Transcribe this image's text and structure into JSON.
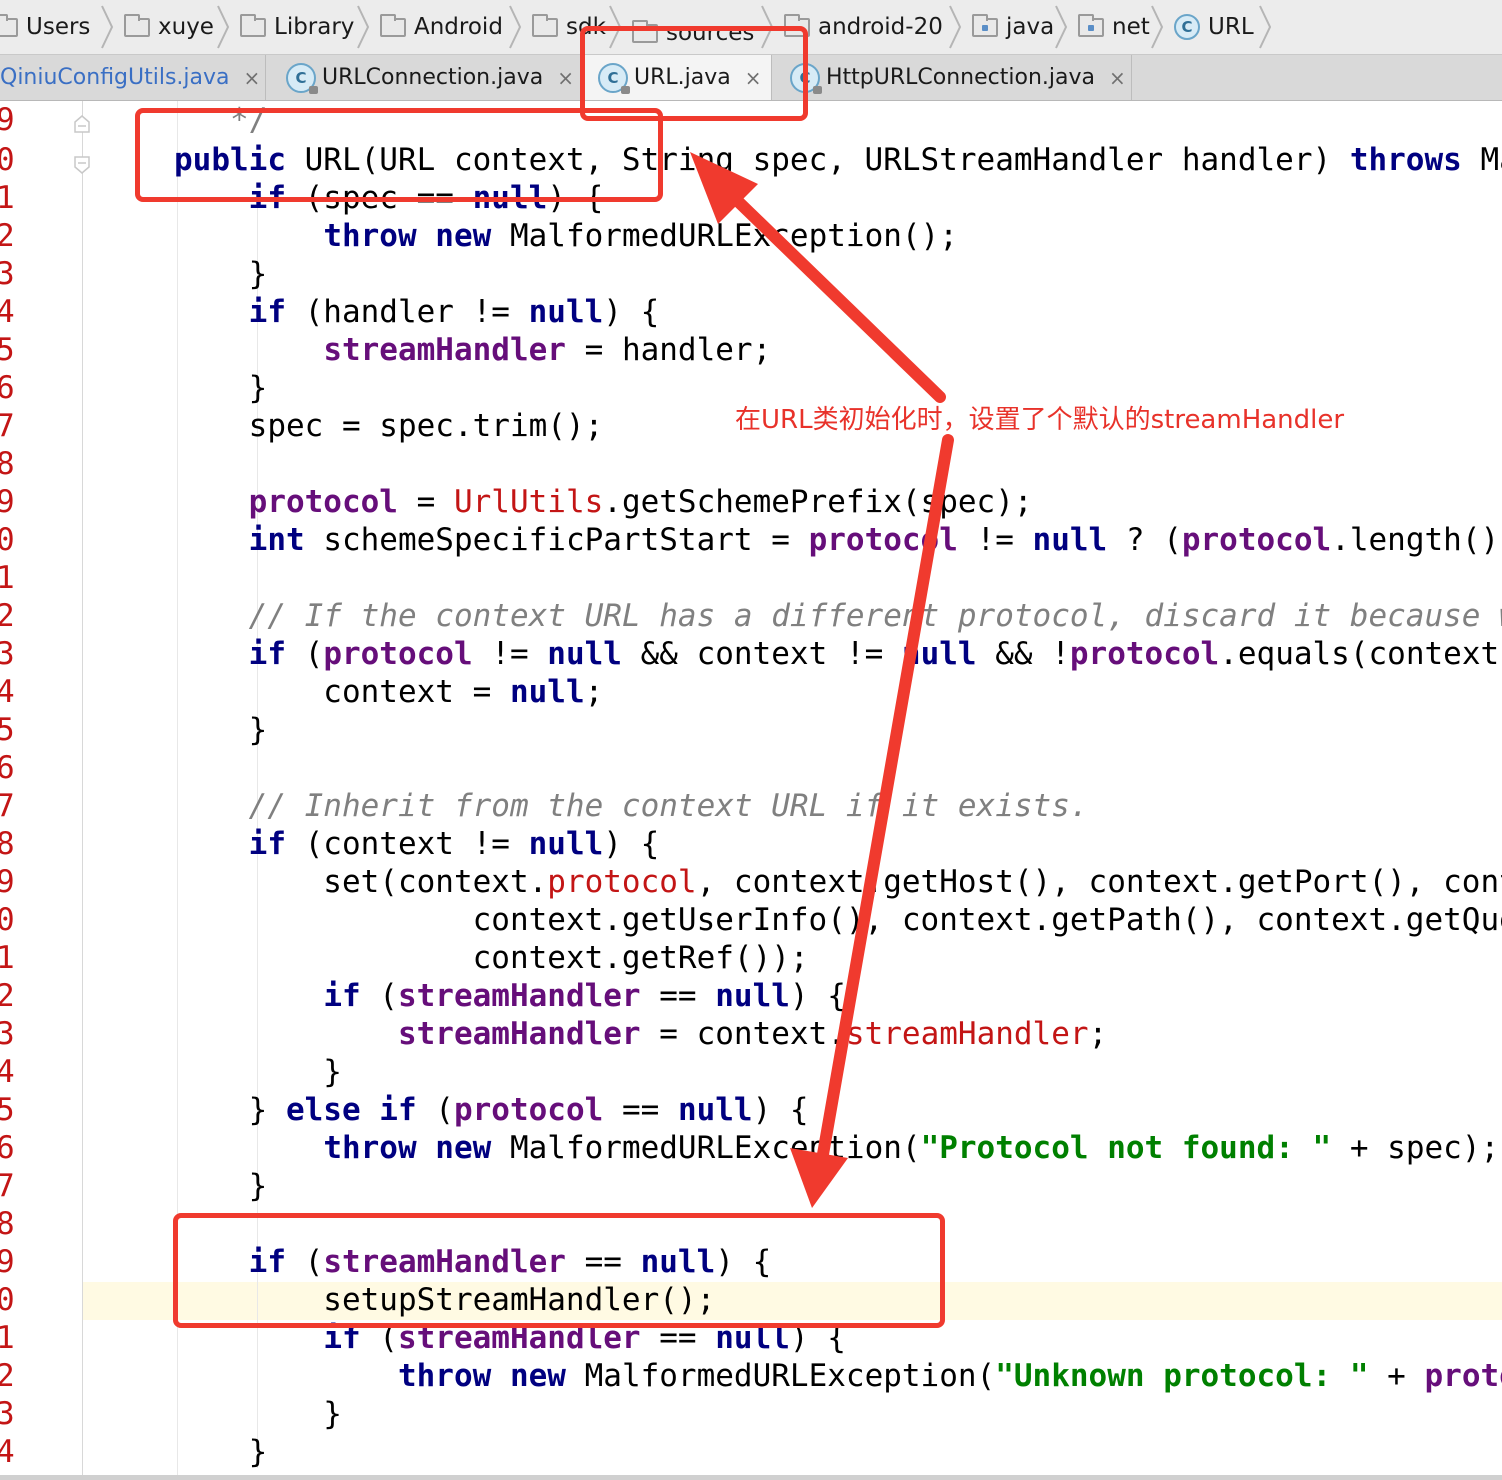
{
  "breadcrumb": [
    {
      "label": "Users",
      "icon": "folder-icon"
    },
    {
      "label": "xuye",
      "icon": "folder-icon"
    },
    {
      "label": "Library",
      "icon": "folder-icon"
    },
    {
      "label": "Android",
      "icon": "folder-icon"
    },
    {
      "label": "sdk",
      "icon": "folder-icon"
    },
    {
      "label": "sources",
      "icon": "folder-icon"
    },
    {
      "label": "android-20",
      "icon": "folder-icon"
    },
    {
      "label": "java",
      "icon": "package-icon"
    },
    {
      "label": "net",
      "icon": "package-icon"
    },
    {
      "label": "URL",
      "icon": "class-icon",
      "glyph": "C"
    }
  ],
  "tabs": [
    {
      "label": "QiniuConfigUtils.java",
      "active": false
    },
    {
      "label": "URLConnection.java",
      "active": false
    },
    {
      "label": "URL.java",
      "active": true
    },
    {
      "label": "HttpURLConnection.java",
      "active": false
    }
  ],
  "tab_close_glyph": "×",
  "tab_icon_glyph": "C",
  "editor": {
    "line_numbers": [
      "9",
      "0",
      "1",
      "2",
      "3",
      "4",
      "5",
      "6",
      "7",
      "8",
      "9",
      "0",
      "1",
      "2",
      "3",
      "4",
      "5",
      "6",
      "7",
      "8",
      "9",
      "0",
      "1",
      "2",
      "3",
      "4",
      "5",
      "6",
      "7",
      "8",
      "9",
      "0",
      "1",
      "2",
      "3",
      "4"
    ],
    "current_line_index": 31
  },
  "annotation": {
    "text": "在URL类初始化时，设置了个默认的streamHandler",
    "color": "#f03a2e"
  },
  "colors": {
    "keyword": "#000080",
    "field": "#660e7a",
    "string": "#008000",
    "comment": "#808080",
    "line_number": "#c31515",
    "annotation_red": "#f03a2e"
  }
}
